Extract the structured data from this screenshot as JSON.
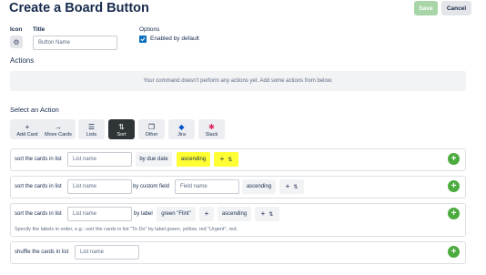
{
  "header": {
    "title": "Create a Board Button",
    "save_label": "Save",
    "cancel_label": "Cancel"
  },
  "form": {
    "icon_label": "Icon",
    "title_label": "Title",
    "title_placeholder": "Button Name",
    "options_label": "Options",
    "enabled_label": "Enabled by default"
  },
  "actions": {
    "heading": "Actions",
    "notice": "Your command doesn't perform any actions yet. Add some actions from below."
  },
  "select_action": {
    "heading": "Select an Action",
    "types": [
      {
        "label": "Add Card",
        "icon": "+"
      },
      {
        "label": "Move Cards",
        "icon": "→"
      },
      {
        "label": "Lists",
        "icon": "☰"
      },
      {
        "label": "Sort",
        "icon": "⇅"
      },
      {
        "label": "Other",
        "icon": "❐"
      },
      {
        "label": "Jira",
        "icon": "◆"
      },
      {
        "label": "Slack",
        "icon": "✱"
      }
    ]
  },
  "rows": [
    {
      "text": "sort the cards in list",
      "input_placeholder": "List name",
      "by": "by due date",
      "order": "ascending"
    },
    {
      "text": "sort the cards in list",
      "input_placeholder": "List name",
      "by": "by custom field",
      "field_placeholder": "Field name",
      "order": "ascending"
    },
    {
      "text": "sort the cards in list",
      "input_placeholder": "List name",
      "by": "by label",
      "label_value": "green \"Flint\"",
      "order": "ascending",
      "hint": "Specify the labels in order, e.g.: sort the cards in list \"To Do\" by label green, yellow, red \"Urgent\", red."
    },
    {
      "text": "shuffle the cards in list",
      "input_placeholder": "List name"
    }
  ],
  "colors": {
    "add_button": "#4bab3e",
    "highlight": "#ffff33",
    "active_tab": "#2f3437"
  }
}
